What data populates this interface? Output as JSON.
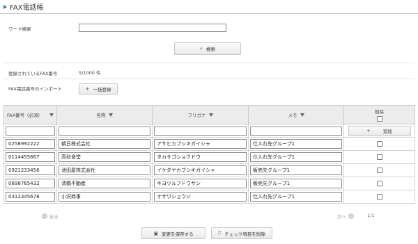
{
  "header": {
    "title": "FAX電話帳"
  },
  "search": {
    "label": "ワード検索",
    "value": "",
    "button_label": "検索"
  },
  "registered": {
    "label": "登録されているFAX番号",
    "value": "5/1000 件"
  },
  "import": {
    "label": "FAX電話番号のインポート",
    "button_label": "一括登録"
  },
  "table": {
    "columns": [
      "FAX番号（必須）",
      "名称",
      "フリガナ",
      "メモ",
      "削除"
    ],
    "add_label": "追加",
    "rows": [
      {
        "fax": "0258992222",
        "name": "朝日株式会社",
        "kana": "アサヒカブシキガイシャ",
        "memo": "仕入れ先グループ1"
      },
      {
        "fax": "0114455667",
        "name": "高砂食堂",
        "kana": "タカサゴショクドウ",
        "memo": "仕入れ先グループ1"
      },
      {
        "fax": "0921233456",
        "name": "池田屋株式会社",
        "kana": "イケダヤカブシキガイシャ",
        "memo": "販売先グループ1"
      },
      {
        "fax": "0698765432",
        "name": "清鶴不動産",
        "kana": "キヨツルフドウサン",
        "memo": "販売先グループ1"
      },
      {
        "fax": "0312345678",
        "name": "小沢商事",
        "kana": "オザワショウジ",
        "memo": "仕入れ先グループ1"
      }
    ]
  },
  "pager": {
    "prev_label": "戻る",
    "next_label": "次へ",
    "page": "1/1"
  },
  "footer": {
    "save_label": "変更を保存する",
    "delete_label": "チェック項目を削除"
  }
}
